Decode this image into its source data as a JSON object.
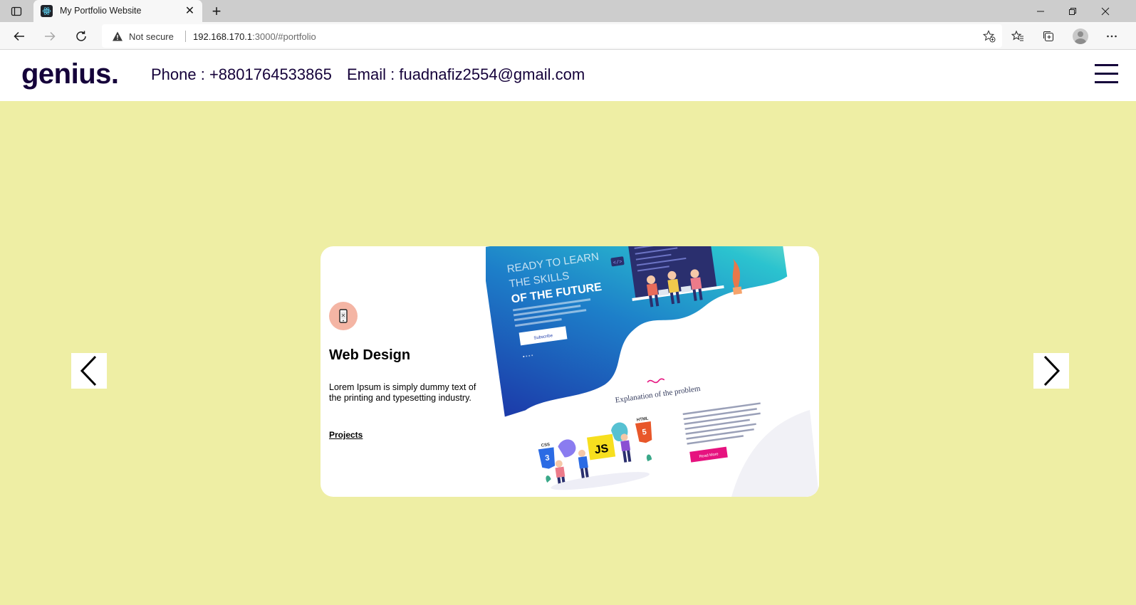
{
  "browser": {
    "tab_title": "My Portfolio Website",
    "tab_close": "✕",
    "new_tab": "+",
    "security_label": "Not secure",
    "url_host": "192.168.170.1",
    "url_rest": ":3000/#portfolio"
  },
  "header": {
    "logo": "genius.",
    "phone": "Phone : +8801764533865",
    "email": "Email : fuadnafiz2554@gmail.com"
  },
  "portfolio": {
    "card": {
      "title": "Web Design",
      "description": "Lorem Ipsum is simply dummy text of the printing and typesetting industry.",
      "link": "Projects"
    },
    "mockup": {
      "headline_1": "READY TO LEARN",
      "headline_2": "THE SKILLS",
      "headline_3": "OF THE FUTURE",
      "subscribe_label": "Subscribe",
      "section_title": "Explanation of the problem",
      "read_more_label": "Read More",
      "css_label": "CSS",
      "js_label": "JS",
      "html_label": "HTML"
    }
  },
  "colors": {
    "background": "#eeeea4",
    "text_dark": "#15023a",
    "icon_circle": "#f4b5a4",
    "accent_pink": "#e6137f"
  }
}
